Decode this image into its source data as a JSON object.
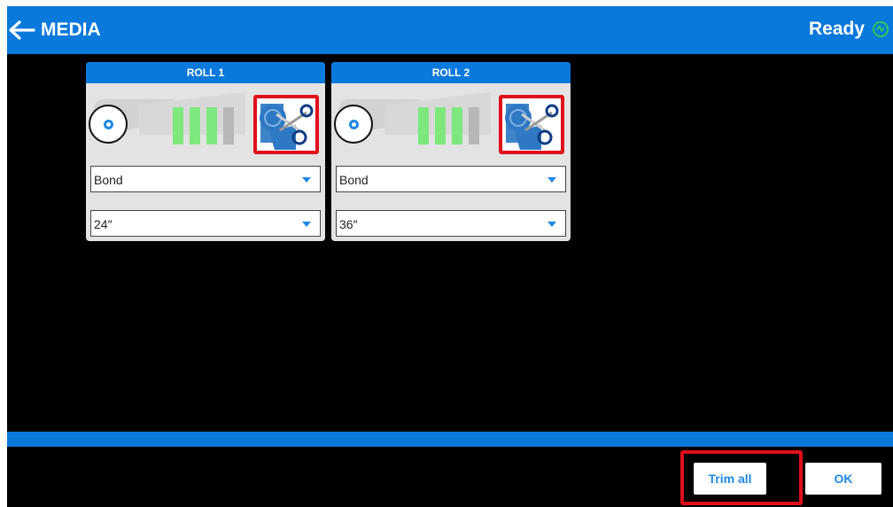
{
  "header": {
    "title": "MEDIA",
    "status": "Ready"
  },
  "rolls": [
    {
      "title": "ROLL 1",
      "media_type": "Bond",
      "width": "24″",
      "level_on": 3,
      "level_total": 4
    },
    {
      "title": "ROLL 2",
      "media_type": "Bond",
      "width": "36″",
      "level_on": 3,
      "level_total": 4
    }
  ],
  "footer": {
    "trim_all_label": "Trim all",
    "ok_label": "OK"
  },
  "icons": {
    "back": "arrow-left-icon",
    "status": "ready-clock-icon",
    "spool": "roll-spool-icon",
    "trim": "scissors-trim-icon",
    "caret": "chevron-down-icon"
  },
  "colors": {
    "accent": "#0a79dc",
    "level_on": "#7ee87e",
    "level_off": "#b7b7b7",
    "highlight": "#e0101a"
  }
}
